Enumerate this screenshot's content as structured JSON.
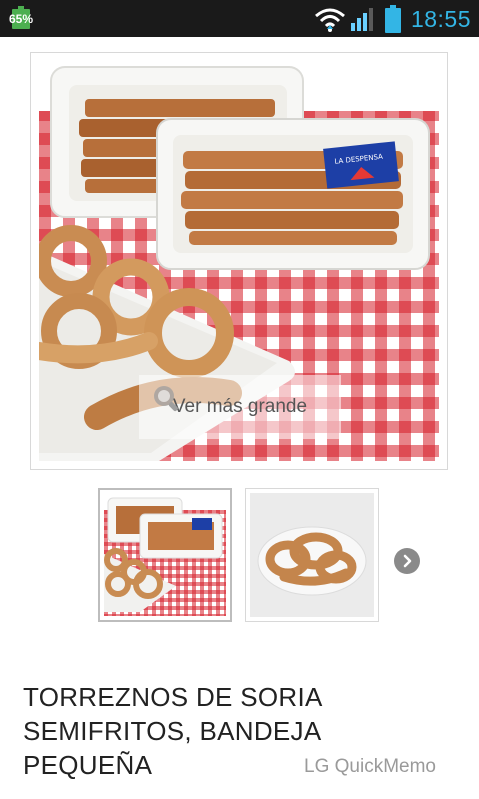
{
  "status_bar": {
    "battery_left_percent": "65%",
    "clock": "18:55",
    "icons": [
      "battery-charging-icon",
      "wifi-icon",
      "signal-icon",
      "battery-icon"
    ],
    "accent_color": "#33b5e5"
  },
  "product": {
    "main_image_zoom_label": "Ver más grande",
    "title": "TORREZNOS DE SORIA SEMIFRITOS, BANDEJA PEQUEÑA",
    "tray_label_text": "LA DESPENSA"
  },
  "thumbnails": {
    "count": 2,
    "selected_index": 0,
    "next_icon": "chevron-right-icon"
  },
  "watermark": "LG QuickMemo"
}
